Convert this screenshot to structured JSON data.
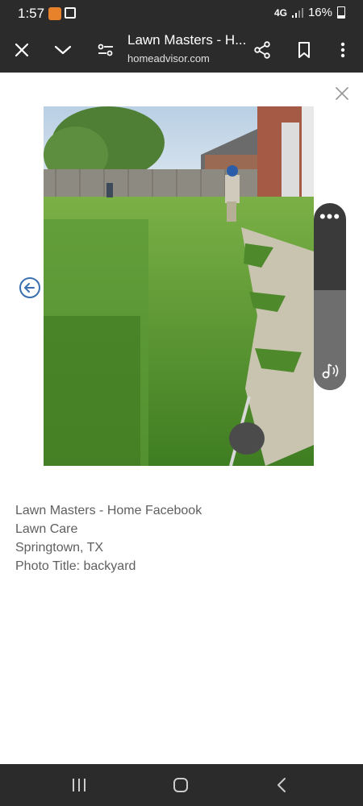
{
  "status_bar": {
    "time": "1:57",
    "network": "4G",
    "battery": "16%"
  },
  "toolbar": {
    "title": "Lawn Masters - H...",
    "url": "homeadvisor.com"
  },
  "caption": {
    "line1": "Lawn Masters - Home Facebook",
    "line2": "Lawn Care",
    "line3": "Springtown, TX",
    "line4": "Photo Title: backyard"
  },
  "colors": {
    "bar_bg": "#2b2b2b",
    "caption_text": "#5f5f5f",
    "prev_button": "#3a6fb0"
  },
  "icons": {
    "close": "close-icon",
    "collapse": "chevron-down-icon",
    "tune": "tune-icon",
    "share": "share-icon",
    "bookmark": "bookmark-icon",
    "menu": "more-vert-icon",
    "prev": "arrow-left-circle-icon",
    "audio": "audio-icon"
  }
}
